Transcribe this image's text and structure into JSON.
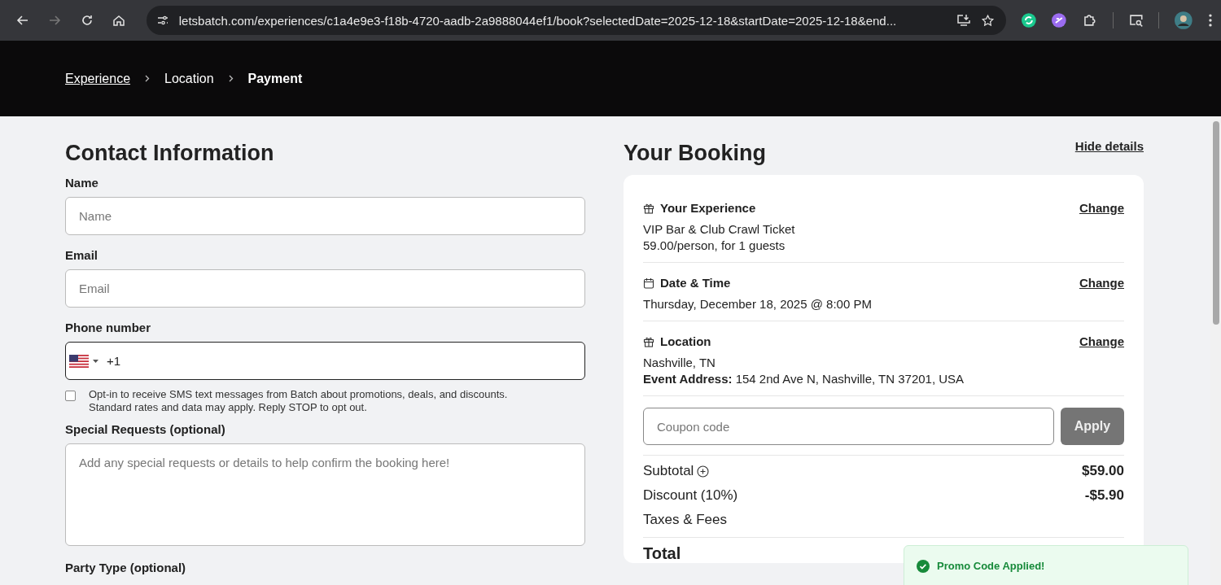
{
  "browser": {
    "nav": [
      {
        "kind": "back",
        "disabled": false
      },
      {
        "kind": "forward",
        "disabled": true
      },
      {
        "kind": "reload",
        "disabled": false
      },
      {
        "kind": "home",
        "disabled": false
      }
    ],
    "url": "letsbatch.com/experiences/c1a4e9e3-f18b-4720-aadb-2a9888044ef1/book?selectedDate=2025-12-18&startDate=2025-12-18&end..."
  },
  "breadcrumb": [
    {
      "label": "Experience",
      "linked": true,
      "selected": false
    },
    {
      "label": "Location",
      "linked": false,
      "selected": false
    },
    {
      "label": "Payment",
      "linked": false,
      "selected": true
    }
  ],
  "contact": {
    "title": "Contact Information",
    "fields": [
      {
        "label": "Name",
        "placeholder": "Name"
      },
      {
        "label": "Email",
        "placeholder": "Email"
      }
    ],
    "phone": {
      "label": "Phone number",
      "code": "+1"
    },
    "sms_opt_in": {
      "checked": false,
      "lines": [
        "Opt-in to receive SMS text messages from Batch about promotions, deals, and discounts.",
        "Standard rates and data may apply. Reply STOP to opt out."
      ]
    },
    "special_requests": {
      "label": "Special Requests (optional)",
      "placeholder": "Add any special requests or details to help confirm the booking here!"
    },
    "party_type": {
      "label": "Party Type (optional)"
    }
  },
  "booking": {
    "title": "Your Booking",
    "hide_link": "Hide details",
    "sections": [
      {
        "kind": "gift",
        "title": "Your Experience",
        "action": "Change",
        "lines": [
          "VIP Bar & Club Crawl Ticket",
          "59.00/person, for 1 guests"
        ]
      },
      {
        "kind": "calendar",
        "title": "Date & Time",
        "action": "Change",
        "lines": [
          "Thursday, December 18, 2025 @ 8:00 PM"
        ]
      },
      {
        "kind": "gift",
        "title": "Location",
        "action": "Change",
        "lines": [
          "Nashville, TN",
          "**Event Address:** 154 2nd Ave N, Nashville, TN 37201, USA"
        ]
      }
    ],
    "coupon": {
      "placeholder": "Coupon code",
      "button": "Apply",
      "disabled": true
    },
    "totals": [
      {
        "label": "Subtotal",
        "info": true,
        "value": "$59.00"
      },
      {
        "label": "Discount (10%)",
        "info": false,
        "value": "-$5.90"
      },
      {
        "label": "Taxes & Fees",
        "info": false
      }
    ],
    "total_label": "Total"
  },
  "toast": {
    "text": "Promo Code Applied!"
  }
}
